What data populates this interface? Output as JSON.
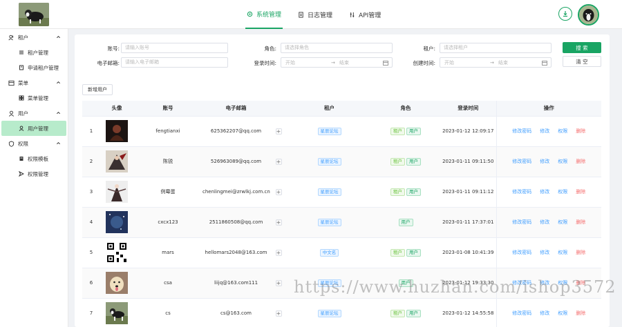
{
  "header": {
    "nav": [
      {
        "label": "系统管理",
        "icon": "gear-icon",
        "active": true
      },
      {
        "label": "日志管理",
        "icon": "document-icon",
        "active": false
      },
      {
        "label": "API管理",
        "icon": "sliders-icon",
        "active": false
      }
    ]
  },
  "sidebar": {
    "groups": [
      {
        "label": "租户",
        "icon": "users-icon",
        "items": [
          {
            "label": "租户管理",
            "icon": "list-icon"
          },
          {
            "label": "申请租户管理",
            "icon": "apply-icon"
          }
        ]
      },
      {
        "label": "菜单",
        "icon": "menu-icon",
        "items": [
          {
            "label": "菜单管理",
            "icon": "grid-icon"
          }
        ]
      },
      {
        "label": "用户",
        "icon": "user-icon",
        "items": [
          {
            "label": "用户管理",
            "icon": "user-icon",
            "active": true
          }
        ]
      },
      {
        "label": "权限",
        "icon": "shield-icon",
        "items": [
          {
            "label": "权限模板",
            "icon": "template-icon"
          },
          {
            "label": "权限管理",
            "icon": "send-icon"
          }
        ]
      }
    ]
  },
  "filters": {
    "account_label": "账号:",
    "account_placeholder": "请输入账号",
    "role_label": "角色:",
    "role_placeholder": "请选择角色",
    "tenant_label": "租户:",
    "tenant_placeholder": "请选择租户",
    "email_label": "电子邮箱:",
    "email_placeholder": "请输入电子邮箱",
    "login_time_label": "登录时间:",
    "create_time_label": "创建时间:",
    "range_start": "开始",
    "range_end": "结束",
    "range_sep": "→",
    "search_label": "搜 索",
    "clear_label": "清 空"
  },
  "add_user_label": "新增用户",
  "table": {
    "columns": [
      "",
      "头像",
      "账号",
      "电子邮箱",
      "",
      "租户",
      "角色",
      "登录时间",
      "操作"
    ],
    "actions": {
      "change_password": "修改密码",
      "edit": "修改",
      "permission": "权限",
      "delete": "删除"
    },
    "rows": [
      {
        "index": "1",
        "avatar": "dark-photo",
        "account": "fengtianxi",
        "email": "625362207@qq.com",
        "tenants": [
          "星辰论坛"
        ],
        "roles": [
          "租户",
          "用户"
        ],
        "login_time": "2023-01-12 12:09:17"
      },
      {
        "index": "2",
        "avatar": "character-art",
        "account": "陈锐",
        "email": "526963089@qq.com",
        "tenants": [
          "星辰论坛"
        ],
        "roles": [
          "租户",
          "用户"
        ],
        "login_time": "2023-01-11 09:11:50"
      },
      {
        "index": "3",
        "avatar": "anime-figure",
        "account": "例霉蛋",
        "email": "chenlingmei@zrwlkj.com.cn",
        "tenants": [
          "星辰论坛"
        ],
        "roles": [
          "租户",
          "用户"
        ],
        "login_time": "2023-01-11 09:11:12"
      },
      {
        "index": "4",
        "avatar": "night-sky",
        "account": "cxcx123",
        "email": "2511860508@qq.com",
        "tenants": [
          "星辰论坛"
        ],
        "roles": [
          "用户"
        ],
        "login_time": "2023-01-11 17:37:01"
      },
      {
        "index": "5",
        "avatar": "qr-code",
        "account": "mars",
        "email": "hellomars2048@163.com",
        "tenants": [
          "中文名"
        ],
        "roles": [
          "租户",
          "用户"
        ],
        "login_time": "2023-01-08 10:41:39"
      },
      {
        "index": "6",
        "avatar": "dog-photo",
        "account": "csa",
        "email": "liijq@163.com111",
        "tenants": [
          "星辰论坛"
        ],
        "roles": [
          "用户"
        ],
        "login_time": "2023-01-12 19:33:30"
      },
      {
        "index": "7",
        "avatar": "collie-photo",
        "account": "cs",
        "email": "cs@163.com",
        "tenants": [
          "星辰论坛"
        ],
        "roles": [
          "租户",
          "用户"
        ],
        "login_time": "2023-01-12 14:55:58"
      }
    ]
  },
  "watermark": "https://www.huzhan.com/ishop3572",
  "colors": {
    "brand": "#19a463",
    "link": "#409eff",
    "danger": "#f56c6c",
    "active_bg": "#b7ebcb"
  }
}
